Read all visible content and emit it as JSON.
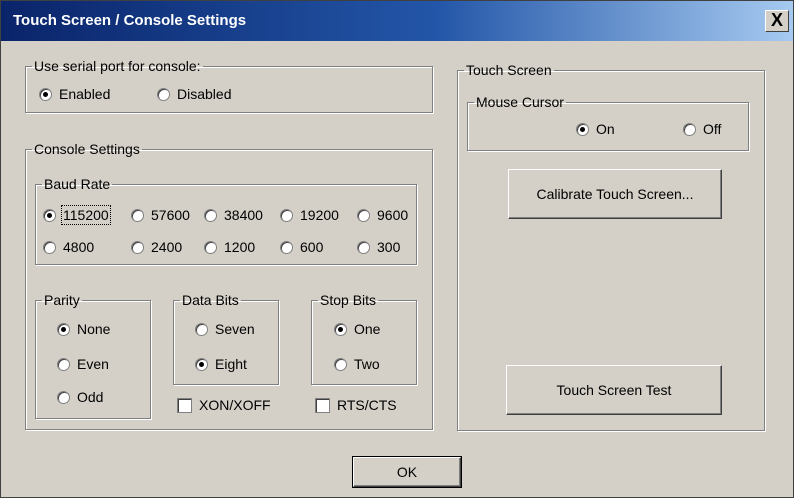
{
  "window": {
    "title": "Touch Screen / Console Settings",
    "close_label": "X"
  },
  "serial_port": {
    "legend": "Use serial port for console:",
    "options": [
      {
        "label": "Enabled",
        "selected": true
      },
      {
        "label": "Disabled",
        "selected": false
      }
    ]
  },
  "console": {
    "legend": "Console Settings",
    "baud": {
      "legend": "Baud Rate",
      "options": [
        {
          "label": "115200",
          "selected": true
        },
        {
          "label": "57600",
          "selected": false
        },
        {
          "label": "38400",
          "selected": false
        },
        {
          "label": "19200",
          "selected": false
        },
        {
          "label": "9600",
          "selected": false
        },
        {
          "label": "4800",
          "selected": false
        },
        {
          "label": "2400",
          "selected": false
        },
        {
          "label": "1200",
          "selected": false
        },
        {
          "label": "600",
          "selected": false
        },
        {
          "label": "300",
          "selected": false
        }
      ]
    },
    "parity": {
      "legend": "Parity",
      "options": [
        {
          "label": "None",
          "selected": true
        },
        {
          "label": "Even",
          "selected": false
        },
        {
          "label": "Odd",
          "selected": false
        }
      ]
    },
    "data_bits": {
      "legend": "Data Bits",
      "options": [
        {
          "label": "Seven",
          "selected": false
        },
        {
          "label": "Eight",
          "selected": true
        }
      ]
    },
    "stop_bits": {
      "legend": "Stop Bits",
      "options": [
        {
          "label": "One",
          "selected": true
        },
        {
          "label": "Two",
          "selected": false
        }
      ]
    },
    "xon_xoff": {
      "label": "XON/XOFF",
      "checked": false
    },
    "rts_cts": {
      "label": "RTS/CTS",
      "checked": false
    }
  },
  "touch": {
    "legend": "Touch Screen",
    "mouse_cursor": {
      "legend": "Mouse Cursor",
      "options": [
        {
          "label": "On",
          "selected": true
        },
        {
          "label": "Off",
          "selected": false
        }
      ]
    },
    "calibrate_label": "Calibrate Touch Screen...",
    "test_label": "Touch Screen Test"
  },
  "ok_label": "OK"
}
